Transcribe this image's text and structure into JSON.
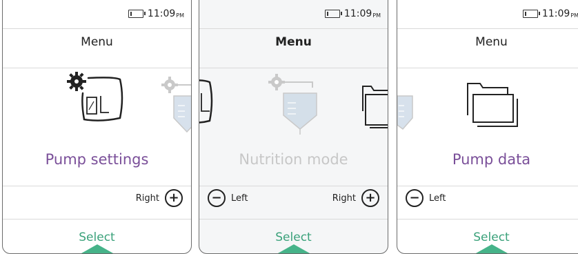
{
  "status": {
    "time": "11:09",
    "ampm": "PM"
  },
  "screens": [
    {
      "title": "Menu",
      "item": "Pump settings",
      "right_label": "Right",
      "select_label": "Select"
    },
    {
      "title": "Menu",
      "item": "Nutrition mode",
      "left_label": "Left",
      "right_label": "Right",
      "select_label": "Select"
    },
    {
      "title": "Menu",
      "item": "Pump data",
      "left_label": "Left",
      "select_label": "Select"
    }
  ],
  "icons": {
    "screen1": [
      "pump-settings-icon",
      "nutrition-mode-icon"
    ],
    "screen2": [
      "pump-settings-icon",
      "nutrition-mode-icon",
      "pump-data-icon"
    ],
    "screen3": [
      "nutrition-mode-icon",
      "pump-data-icon"
    ]
  },
  "colors": {
    "accent_purple": "#7a4f99",
    "select_green": "#3aa17a",
    "ghost_text": "#c7c7c7"
  }
}
